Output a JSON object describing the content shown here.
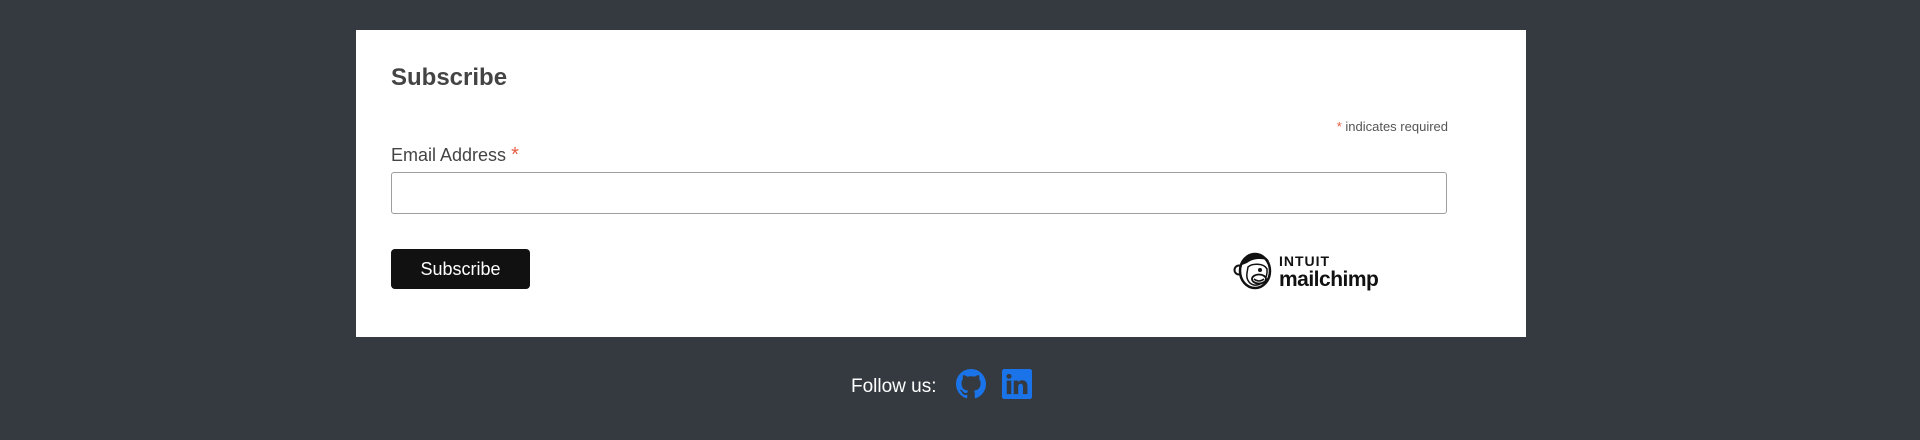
{
  "form": {
    "title": "Subscribe",
    "required_asterisk": "*",
    "required_note": "indicates required",
    "email_label": "Email Address",
    "email_value": "",
    "email_placeholder": "",
    "submit_label": "Subscribe",
    "badge": {
      "line1": "INTUIT",
      "line2": "mailchimp"
    }
  },
  "footer": {
    "follow_label": "Follow us:",
    "links": [
      {
        "icon": "github-icon",
        "color": "#1a73e8"
      },
      {
        "icon": "linkedin-icon",
        "color": "#1a73e8"
      }
    ]
  },
  "colors": {
    "page_background": "#343a40",
    "card_background": "#ffffff",
    "button_background": "#111111",
    "required_asterisk": "#e85c41",
    "social_icons": "#1a73e8"
  }
}
